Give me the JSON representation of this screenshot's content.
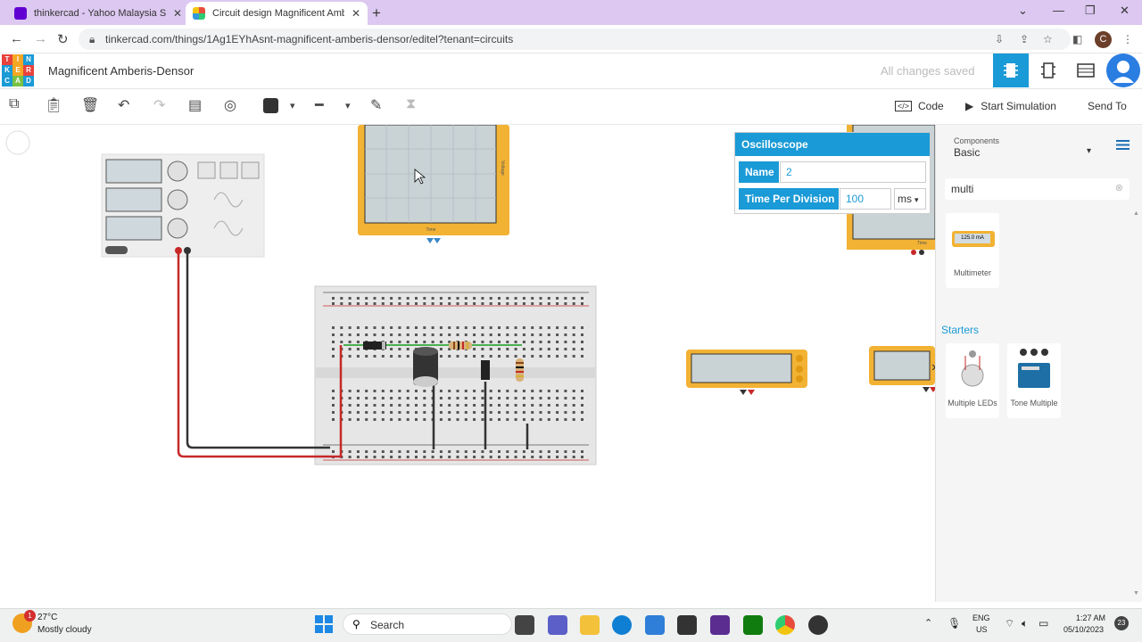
{
  "browser": {
    "tabs": [
      {
        "title": "thinkercad - Yahoo Malaysia Sear",
        "active": false
      },
      {
        "title": "Circuit design Magnificent Ambe",
        "active": true
      }
    ],
    "new_tab": "+",
    "url": "tinkercad.com/things/1Ag1EYhAsnt-magnificent-amberis-densor/editel?tenant=circuits",
    "profile_initial": "C"
  },
  "app": {
    "logo_letters": [
      "T",
      "I",
      "N",
      "K",
      "E",
      "R",
      "C",
      "A",
      "D"
    ],
    "title": "Magnificent Amberis-Densor",
    "save_status": "All changes saved"
  },
  "toolbar": {
    "code_label": "Code",
    "start_sim_label": "Start Simulation",
    "send_to_label": "Send To"
  },
  "inspector": {
    "title": "Oscilloscope",
    "name_label": "Name",
    "name_value": "2",
    "time_label": "Time Per Division",
    "time_value": "100",
    "time_unit": "ms"
  },
  "panel": {
    "components_label": "Components",
    "components_value": "Basic",
    "search_value": "multi",
    "results": [
      {
        "label": "Multimeter",
        "display": "125.0 mA"
      }
    ],
    "starters_label": "Starters",
    "starters": [
      {
        "label": "Multiple LEDs"
      },
      {
        "label": "Tone Multiple"
      }
    ]
  },
  "canvas": {
    "scope_top_axis": "Voltage",
    "scope_bottom_axis": "Time",
    "scope_right_axis": "Time"
  },
  "taskbar": {
    "weather_temp": "27°C",
    "weather_desc": "Mostly cloudy",
    "weather_badge": "1",
    "search_label": "Search",
    "lang_line1": "ENG",
    "lang_line2": "US",
    "time": "1:27 AM",
    "date": "05/10/2023",
    "notif_count": "23"
  }
}
